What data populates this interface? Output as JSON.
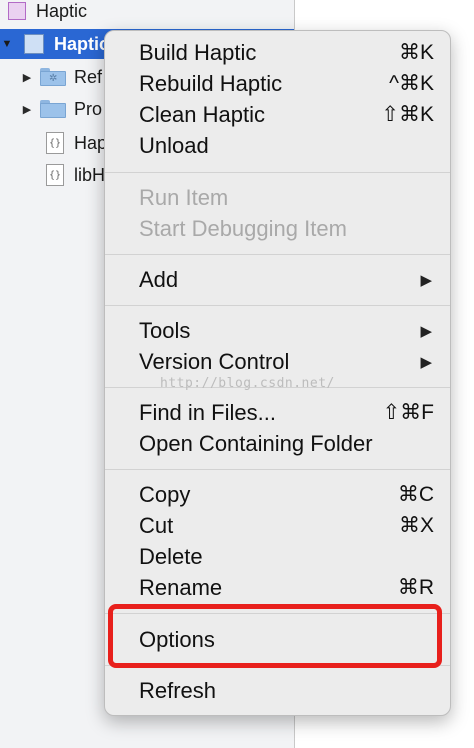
{
  "sidebar": {
    "top_item": "Haptic",
    "selected_item": "Haptic",
    "items": [
      {
        "label": "Ref",
        "icon": "folder-gear-icon"
      },
      {
        "label": "Pro",
        "icon": "folder-icon"
      },
      {
        "label": "Hap",
        "icon": "file-icon"
      },
      {
        "label": "libH",
        "icon": "file-icon"
      }
    ],
    "file_glyph": "{}"
  },
  "menu": {
    "build": {
      "label": "Build Haptic",
      "shortcut": "⌘K"
    },
    "rebuild": {
      "label": "Rebuild Haptic",
      "shortcut": "^⌘K"
    },
    "clean": {
      "label": "Clean Haptic",
      "shortcut": "⇧⌘K"
    },
    "unload": {
      "label": "Unload"
    },
    "run_item": {
      "label": "Run Item"
    },
    "start_debugging": {
      "label": "Start Debugging Item"
    },
    "add": {
      "label": "Add",
      "submenu_glyph": "▶"
    },
    "tools": {
      "label": "Tools",
      "submenu_glyph": "▶"
    },
    "version_control": {
      "label": "Version Control",
      "submenu_glyph": "▶"
    },
    "find_in_files": {
      "label": "Find in Files...",
      "shortcut": "⇧⌘F"
    },
    "open_containing_folder": {
      "label": "Open Containing Folder"
    },
    "copy": {
      "label": "Copy",
      "shortcut": "⌘C"
    },
    "cut": {
      "label": "Cut",
      "shortcut": "⌘X"
    },
    "delete": {
      "label": "Delete"
    },
    "rename": {
      "label": "Rename",
      "shortcut": "⌘R"
    },
    "options": {
      "label": "Options"
    },
    "refresh": {
      "label": "Refresh"
    }
  },
  "watermark": "http://blog.csdn.net/",
  "colors": {
    "selection": "#2a67d3",
    "highlight_box": "#e8201c"
  }
}
